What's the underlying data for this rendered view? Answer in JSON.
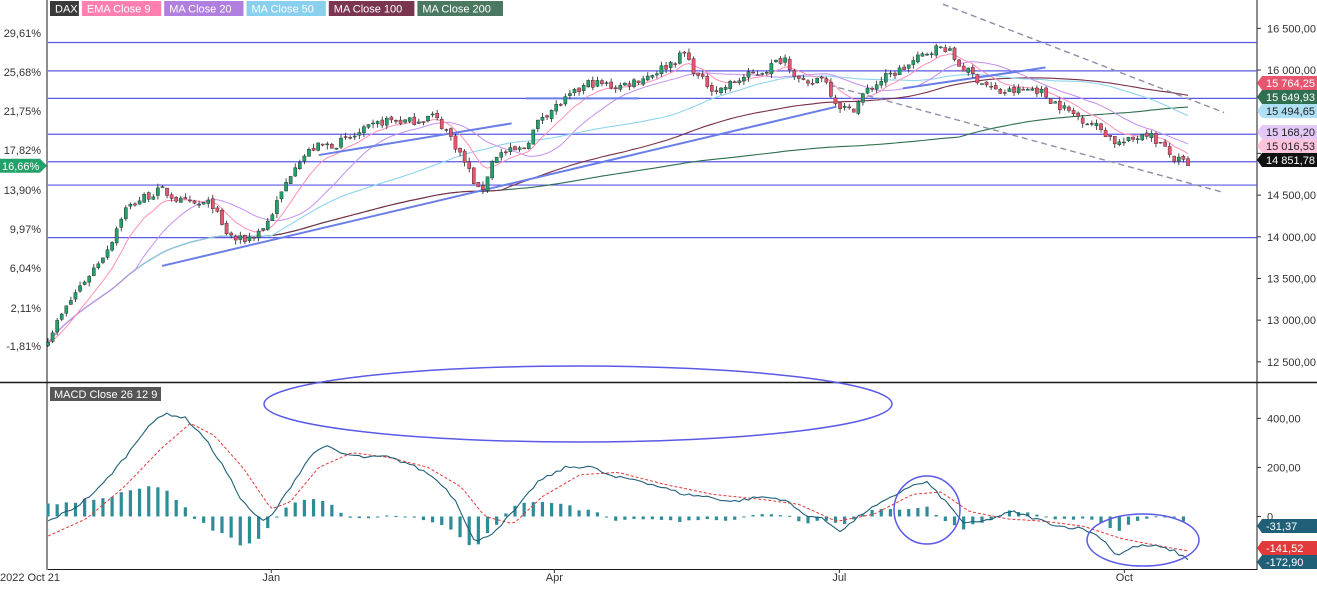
{
  "legend": [
    {
      "label": "DAX",
      "bg": "#3a3a3a",
      "fg": "#ffffff"
    },
    {
      "label": "EMA Close 9",
      "bg": "#ff7fb0",
      "fg": "#ffffff"
    },
    {
      "label": "MA Close 20",
      "bg": "#b07fe0",
      "fg": "#ffffff"
    },
    {
      "label": "MA Close 50",
      "bg": "#88d0ee",
      "fg": "#ffffff"
    },
    {
      "label": "MA Close 100",
      "bg": "#7a3550",
      "fg": "#ffffff"
    },
    {
      "label": "MA Close 200",
      "bg": "#4a7860",
      "fg": "#ffffff"
    }
  ],
  "macd_label": "MACD Close 26 12 9",
  "colors": {
    "up": "#24a06a",
    "down": "#e8556f",
    "hline": "#5a5ae6",
    "trend": "#6a7ee8",
    "ema9": "#ff8fb8",
    "ma20": "#c48ff0",
    "ma50": "#8fd4f0",
    "ma100": "#7a2f4a",
    "ma200": "#2f7050",
    "macd_line": "#1f5f78",
    "signal_line": "#e23a3a",
    "hist": "#2e8c98",
    "hist_pos_recent": "#4a90e2"
  },
  "chart_data": [
    {
      "type": "candlestick",
      "x_ticks": [
        "2022 Oct 21",
        "Jan",
        "Apr",
        "Jul",
        "Oct"
      ],
      "x_tick_months": [
        0,
        2.35,
        5.33,
        8.33,
        11.33
      ],
      "y_ticks_right": [
        "16 500,00",
        "16 000,00",
        "15 500,00",
        "15 000,00",
        "14 500,00",
        "14 000,00",
        "13 500,00",
        "13 000,00",
        "12 500,00"
      ],
      "y_tick_values": [
        16500,
        16000,
        15500,
        15000,
        14500,
        14000,
        13500,
        13000,
        12500
      ],
      "y_ticks_left": [
        "29,61%",
        "25,68%",
        "21,75%",
        "17,82%",
        "13,90%",
        "9,97%",
        "6,04%",
        "2,11%",
        "-1,81%"
      ],
      "ylim": [
        12270,
        16840
      ],
      "price_labels": [
        {
          "text": "15 764,25",
          "value": 15764.25,
          "bg": "#e8556f",
          "fg": "#ffffff"
        },
        {
          "text": "15 649,93",
          "value": 15649.93,
          "bg": "#2f7050",
          "fg": "#ffffff"
        },
        {
          "text": "15 494,65",
          "value": 15494.65,
          "bg": "#aee0f5",
          "fg": "#222222"
        },
        {
          "text": "15 168,20",
          "value": 15168.2,
          "bg": "#e4c8f8",
          "fg": "#222222"
        },
        {
          "text": "15 016,53",
          "value": 15016.53,
          "bg": "#ffc4dc",
          "fg": "#222222"
        },
        {
          "text": "14 851,78",
          "value": 14851.78,
          "bg": "#111111",
          "fg": "#ffffff"
        }
      ],
      "current_pct_label": "16,66%",
      "horizontal_levels": [
        16330,
        15990,
        15660,
        15230,
        14900,
        14620,
        13990
      ],
      "keypoints": [
        [
          0,
          12790
        ],
        [
          0.14,
          13050
        ],
        [
          0.3,
          13350
        ],
        [
          0.47,
          13600
        ],
        [
          0.65,
          13900
        ],
        [
          0.8,
          14320
        ],
        [
          1.0,
          14470
        ],
        [
          1.2,
          14560
        ],
        [
          1.4,
          14420
        ],
        [
          1.55,
          14380
        ],
        [
          1.73,
          14400
        ],
        [
          1.85,
          14070
        ],
        [
          2.0,
          13950
        ],
        [
          2.15,
          14000
        ],
        [
          2.3,
          14150
        ],
        [
          2.45,
          14500
        ],
        [
          2.6,
          14880
        ],
        [
          2.8,
          15070
        ],
        [
          3.05,
          15120
        ],
        [
          3.25,
          15220
        ],
        [
          3.55,
          15400
        ],
        [
          3.8,
          15380
        ],
        [
          4.05,
          15450
        ],
        [
          4.18,
          15300
        ],
        [
          4.3,
          15080
        ],
        [
          4.45,
          14750
        ],
        [
          4.55,
          14500
        ],
        [
          4.7,
          14980
        ],
        [
          5.0,
          15050
        ],
        [
          5.2,
          15450
        ],
        [
          5.4,
          15600
        ],
        [
          5.7,
          15850
        ],
        [
          6.0,
          15800
        ],
        [
          6.2,
          15880
        ],
        [
          6.35,
          15950
        ],
        [
          6.55,
          16080
        ],
        [
          6.7,
          16200
        ],
        [
          6.85,
          15900
        ],
        [
          7.05,
          15750
        ],
        [
          7.3,
          15900
        ],
        [
          7.55,
          16000
        ],
        [
          7.75,
          16160
        ],
        [
          7.92,
          15850
        ],
        [
          8.0,
          15800
        ],
        [
          8.15,
          15950
        ],
        [
          8.3,
          15600
        ],
        [
          8.45,
          15500
        ],
        [
          8.6,
          15730
        ],
        [
          8.8,
          15900
        ],
        [
          9.05,
          16050
        ],
        [
          9.3,
          16250
        ],
        [
          9.45,
          16270
        ],
        [
          9.6,
          16050
        ],
        [
          9.8,
          15880
        ],
        [
          10.0,
          15730
        ],
        [
          10.2,
          15750
        ],
        [
          10.4,
          15780
        ],
        [
          10.55,
          15650
        ],
        [
          10.75,
          15500
        ],
        [
          10.95,
          15380
        ],
        [
          11.1,
          15280
        ],
        [
          11.25,
          15120
        ],
        [
          11.4,
          15150
        ],
        [
          11.55,
          15270
        ],
        [
          11.7,
          15120
        ],
        [
          11.85,
          14930
        ],
        [
          12.0,
          14870
        ]
      ],
      "trendlines": [
        {
          "style": "solid",
          "points": [
            [
              1.2,
              13650
            ],
            [
              8.3,
              15560
            ]
          ]
        },
        {
          "style": "solid",
          "points": [
            [
              9.0,
              15780
            ],
            [
              10.5,
              16030
            ]
          ]
        },
        {
          "style": "solid",
          "points": [
            [
              2.85,
              14980
            ],
            [
              4.88,
              15360
            ]
          ]
        },
        {
          "style": "solid",
          "points": [
            [
              5.03,
              15660
            ],
            [
              6.22,
              15660
            ]
          ]
        },
        {
          "style": "dashed",
          "points": [
            [
              9.42,
              16790
            ],
            [
              12.38,
              15490
            ]
          ]
        },
        {
          "style": "dashed",
          "points": [
            [
              8.22,
              15820
            ],
            [
              12.38,
              14530
            ]
          ]
        }
      ]
    },
    {
      "type": "macd",
      "y_ticks": [
        "400,00",
        "200,00",
        "0"
      ],
      "y_tick_values": [
        400,
        200,
        0
      ],
      "ylim": [
        -210,
        540
      ],
      "value_labels": [
        {
          "text": "-31,37",
          "value": -31.37,
          "bg": "#1f5f78",
          "fg": "#ffffff"
        },
        {
          "text": "-141,52",
          "value": -141.52,
          "bg": "#e23a3a",
          "fg": "#ffffff"
        },
        {
          "text": "-172,90",
          "value": -172.9,
          "bg": "#1f5f78",
          "fg": "#ffffff"
        }
      ],
      "macd_keypoints": [
        [
          0,
          -20
        ],
        [
          0.3,
          40
        ],
        [
          0.55,
          120
        ],
        [
          0.85,
          260
        ],
        [
          1.05,
          370
        ],
        [
          1.25,
          420
        ],
        [
          1.45,
          400
        ],
        [
          1.65,
          320
        ],
        [
          1.85,
          200
        ],
        [
          2.05,
          60
        ],
        [
          2.25,
          -20
        ],
        [
          2.35,
          0
        ],
        [
          2.55,
          120
        ],
        [
          2.75,
          240
        ],
        [
          2.9,
          290
        ],
        [
          3.1,
          255
        ],
        [
          3.35,
          240
        ],
        [
          3.55,
          245
        ],
        [
          3.8,
          215
        ],
        [
          4.0,
          175
        ],
        [
          4.15,
          130
        ],
        [
          4.3,
          60
        ],
        [
          4.5,
          -110
        ],
        [
          4.7,
          -60
        ],
        [
          4.95,
          40
        ],
        [
          5.15,
          140
        ],
        [
          5.45,
          200
        ],
        [
          5.7,
          205
        ],
        [
          5.95,
          160
        ],
        [
          6.2,
          150
        ],
        [
          6.45,
          120
        ],
        [
          6.7,
          90
        ],
        [
          6.95,
          80
        ],
        [
          7.2,
          60
        ],
        [
          7.5,
          80
        ],
        [
          7.75,
          70
        ],
        [
          7.95,
          10
        ],
        [
          8.15,
          -10
        ],
        [
          8.35,
          -60
        ],
        [
          8.6,
          20
        ],
        [
          8.85,
          70
        ],
        [
          9.05,
          120
        ],
        [
          9.25,
          140
        ],
        [
          9.45,
          60
        ],
        [
          9.65,
          -30
        ],
        [
          9.85,
          -20
        ],
        [
          10.15,
          20
        ],
        [
          10.4,
          -10
        ],
        [
          10.65,
          -40
        ],
        [
          10.9,
          -50
        ],
        [
          11.1,
          -90
        ],
        [
          11.25,
          -160
        ],
        [
          11.45,
          -120
        ],
        [
          11.65,
          -120
        ],
        [
          11.85,
          -140
        ],
        [
          12.0,
          -175
        ]
      ],
      "signal_keypoints": [
        [
          0,
          -80
        ],
        [
          0.4,
          -10
        ],
        [
          0.8,
          120
        ],
        [
          1.2,
          280
        ],
        [
          1.5,
          380
        ],
        [
          1.75,
          330
        ],
        [
          2.05,
          200
        ],
        [
          2.35,
          30
        ],
        [
          2.55,
          60
        ],
        [
          2.85,
          200
        ],
        [
          3.2,
          260
        ],
        [
          3.6,
          240
        ],
        [
          4.0,
          200
        ],
        [
          4.35,
          120
        ],
        [
          4.6,
          0
        ],
        [
          4.9,
          -30
        ],
        [
          5.2,
          80
        ],
        [
          5.6,
          170
        ],
        [
          6.0,
          180
        ],
        [
          6.5,
          130
        ],
        [
          7.0,
          90
        ],
        [
          7.5,
          70
        ],
        [
          7.9,
          50
        ],
        [
          8.3,
          -20
        ],
        [
          8.7,
          10
        ],
        [
          9.1,
          90
        ],
        [
          9.4,
          100
        ],
        [
          9.7,
          20
        ],
        [
          10.1,
          -10
        ],
        [
          10.5,
          -20
        ],
        [
          10.9,
          -40
        ],
        [
          11.3,
          -90
        ],
        [
          11.7,
          -120
        ],
        [
          12.0,
          -140
        ]
      ]
    }
  ]
}
